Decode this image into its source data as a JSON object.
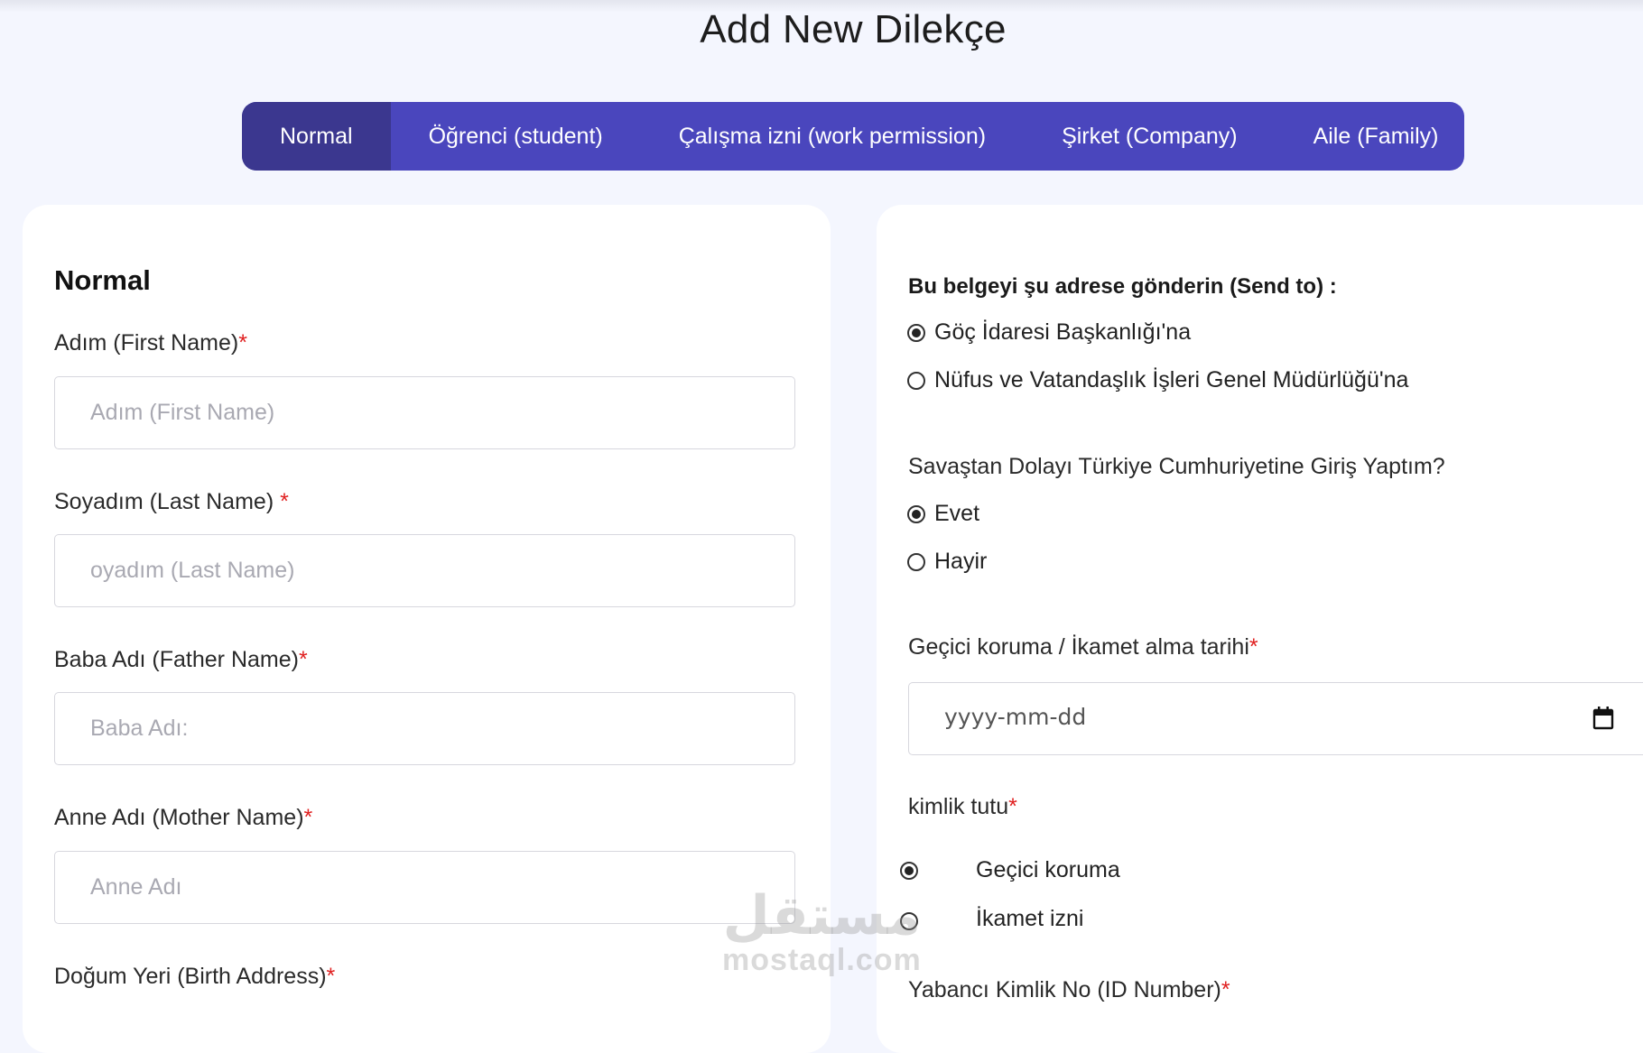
{
  "page_title": "Add New Dilekçe",
  "tabs": [
    {
      "label": "Normal",
      "active": true
    },
    {
      "label": "Öğrenci (student)",
      "active": false
    },
    {
      "label": "Çalışma izni (work permission)",
      "active": false
    },
    {
      "label": "Şirket (Company)",
      "active": false
    },
    {
      "label": "Aile (Family)",
      "active": false
    }
  ],
  "left": {
    "section_title": "Normal",
    "required_mark": "*",
    "fields": [
      {
        "label": "Adım (First Name)",
        "placeholder": "Adım (First Name)"
      },
      {
        "label": "Soyadım (Last Name) ",
        "placeholder": "oyadım (Last Name)"
      },
      {
        "label": "Baba Adı (Father Name)",
        "placeholder": "Baba Adı:"
      },
      {
        "label": "Anne Adı (Mother Name)",
        "placeholder": "Anne Adı"
      },
      {
        "label": "Doğum Yeri (Birth Address)"
      }
    ]
  },
  "right": {
    "send_to_label": "Bu belgeyi şu adrese gönderin (Send to) :",
    "send_to_options": [
      "Göç İdaresi Başkanlığı'na",
      "Nüfus ve Vatandaşlık İşleri Genel Müdürlüğü'na"
    ],
    "send_to_selected": 0,
    "war_question": "Savaştan Dolayı Türkiye Cumhuriyetine Giriş Yaptım?",
    "war_options": [
      "Evet",
      "Hayir"
    ],
    "war_selected": 0,
    "date_label": "Geçici koruma / İkamet alma tarihi",
    "date_placeholder": "yyyy-mm-dd",
    "id_type_label": "kimlik tutu",
    "id_type_options": [
      "Geçici koruma",
      "İkamet izni"
    ],
    "id_type_selected": 0,
    "id_number_label": "Yabancı Kimlik No (ID Number)",
    "required_mark": "*"
  },
  "watermark": {
    "arabic": "مستقل",
    "latin": "mostaql.com"
  },
  "colors": {
    "tab_bar": "#4a46bd",
    "tab_active": "#3b378f",
    "required": "#e02020",
    "background": "#f4f6fe"
  }
}
